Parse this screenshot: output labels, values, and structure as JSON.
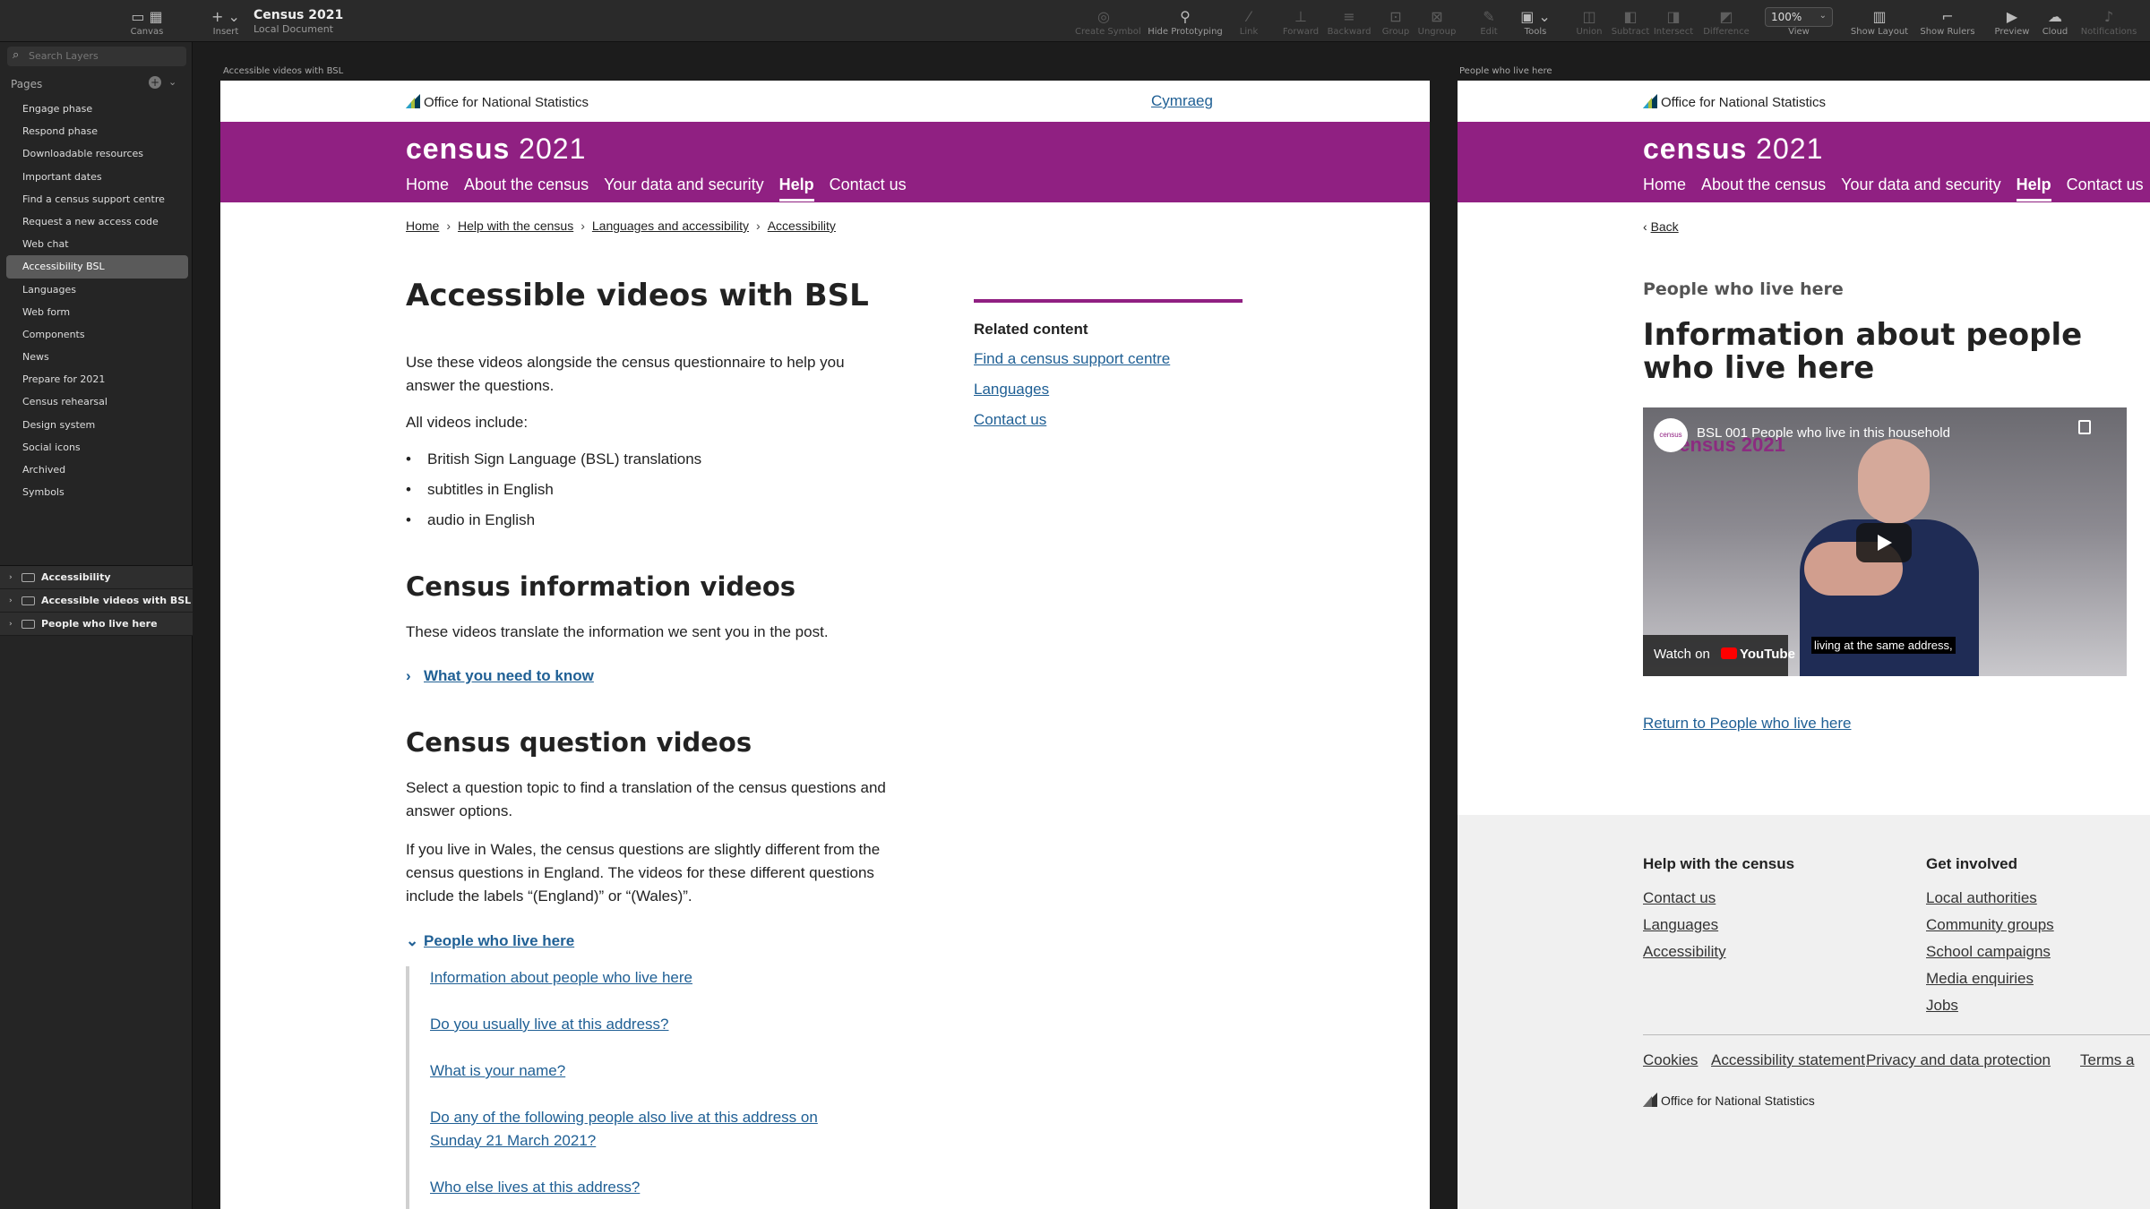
{
  "app": {
    "doc_title": "Census 2021",
    "doc_subtitle": "Local Document",
    "toolbar": {
      "canvas": "Canvas",
      "insert": "Insert",
      "create_symbol": "Create Symbol",
      "hide_prototyping": "Hide Prototyping",
      "link": "Link",
      "forward": "Forward",
      "backward": "Backward",
      "group": "Group",
      "ungroup": "Ungroup",
      "edit": "Edit",
      "tools": "Tools",
      "union": "Union",
      "subtract": "Subtract",
      "intersect": "Intersect",
      "difference": "Difference",
      "zoom": "100%",
      "view": "View",
      "show_layout": "Show Layout",
      "show_rulers": "Show Rulers",
      "preview": "Preview",
      "cloud": "Cloud",
      "notifications": "Notifications"
    }
  },
  "sidebar": {
    "search_placeholder": "Search Layers",
    "pages_header": "Pages",
    "pages": [
      "Engage phase",
      "Respond phase",
      "Downloadable resources",
      "Important dates",
      "Find a census support centre",
      "Request a new access code",
      "Web chat",
      "Accessibility BSL",
      "Languages",
      "Web form",
      "Components",
      "News",
      "Prepare for 2021",
      "Census rehearsal",
      "Design system",
      "Social icons",
      "Archived",
      "Symbols"
    ],
    "active_page": "Accessibility BSL",
    "layers": [
      "Accessibility",
      "Accessible videos with BSL",
      "People who live here"
    ]
  },
  "artboard1": {
    "label": "Accessible videos with BSL",
    "ons": "Office for National Statistics",
    "cymraeg": "Cymraeg",
    "census_word": "census",
    "census_year": "2021",
    "nav": [
      "Home",
      "About the census",
      "Your data and security",
      "Help",
      "Contact us"
    ],
    "breadcrumbs": [
      "Home",
      "Help with the census",
      "Languages and accessibility",
      "Accessibility"
    ],
    "title": "Accessible videos with BSL",
    "intro": "Use these videos alongside the census questionnaire to help you answer the questions.",
    "all_include": "All videos include:",
    "bullets": [
      "British Sign Language (BSL) translations",
      "subtitles in English",
      "audio in English"
    ],
    "info_heading": "Census information videos",
    "info_text": "These videos translate the information we sent you in the post.",
    "info_expander": "What you need to know",
    "question_heading": "Census question videos",
    "question_text": "Select a question topic to find a translation of the census questions and answer options.",
    "wales_text": "If you live in Wales, the census questions are slightly different from the census questions in England. The videos for these different questions include the labels “(England)” or “(Wales)”.",
    "open_expander": "People who live here",
    "sub_links": [
      "Information about people who live here",
      "Do you usually live at this address?",
      "What is your name?",
      "Do any of the following people also live at this address on Sunday 21 March 2021?",
      "Who else lives at this address?"
    ],
    "related": {
      "heading": "Related content",
      "links": [
        "Find a census support centre",
        "Languages",
        "Contact us"
      ]
    }
  },
  "artboard2": {
    "label": "People who live here",
    "ons": "Office for National Statistics",
    "census_word": "census",
    "census_year": "2021",
    "nav": [
      "Home",
      "About the census",
      "Your data and security",
      "Help",
      "Contact us"
    ],
    "back": "Back",
    "section_label": "People who live here",
    "title": "Information about people who live here",
    "video": {
      "title": "BSL 001 People who live in this household",
      "watch_on": "Watch on",
      "youtube": "YouTube",
      "caption": "living at the same address,",
      "watermark": "census 2021"
    },
    "return_link": "Return to People who live here",
    "footer": {
      "help_heading": "Help with the census",
      "help_links": [
        "Contact us",
        "Languages",
        "Accessibility"
      ],
      "involved_heading": "Get involved",
      "involved_links": [
        "Local authorities",
        "Community groups",
        "School campaigns",
        "Media enquiries",
        "Jobs"
      ],
      "legal_links": [
        "Cookies",
        "Accessibility statement",
        "Privacy and data protection",
        "Terms a"
      ],
      "ons": "Office for National Statistics"
    }
  },
  "colors": {
    "census_purple": "#902082",
    "link_blue": "#206095",
    "app_dark": "#1c1c1c"
  }
}
